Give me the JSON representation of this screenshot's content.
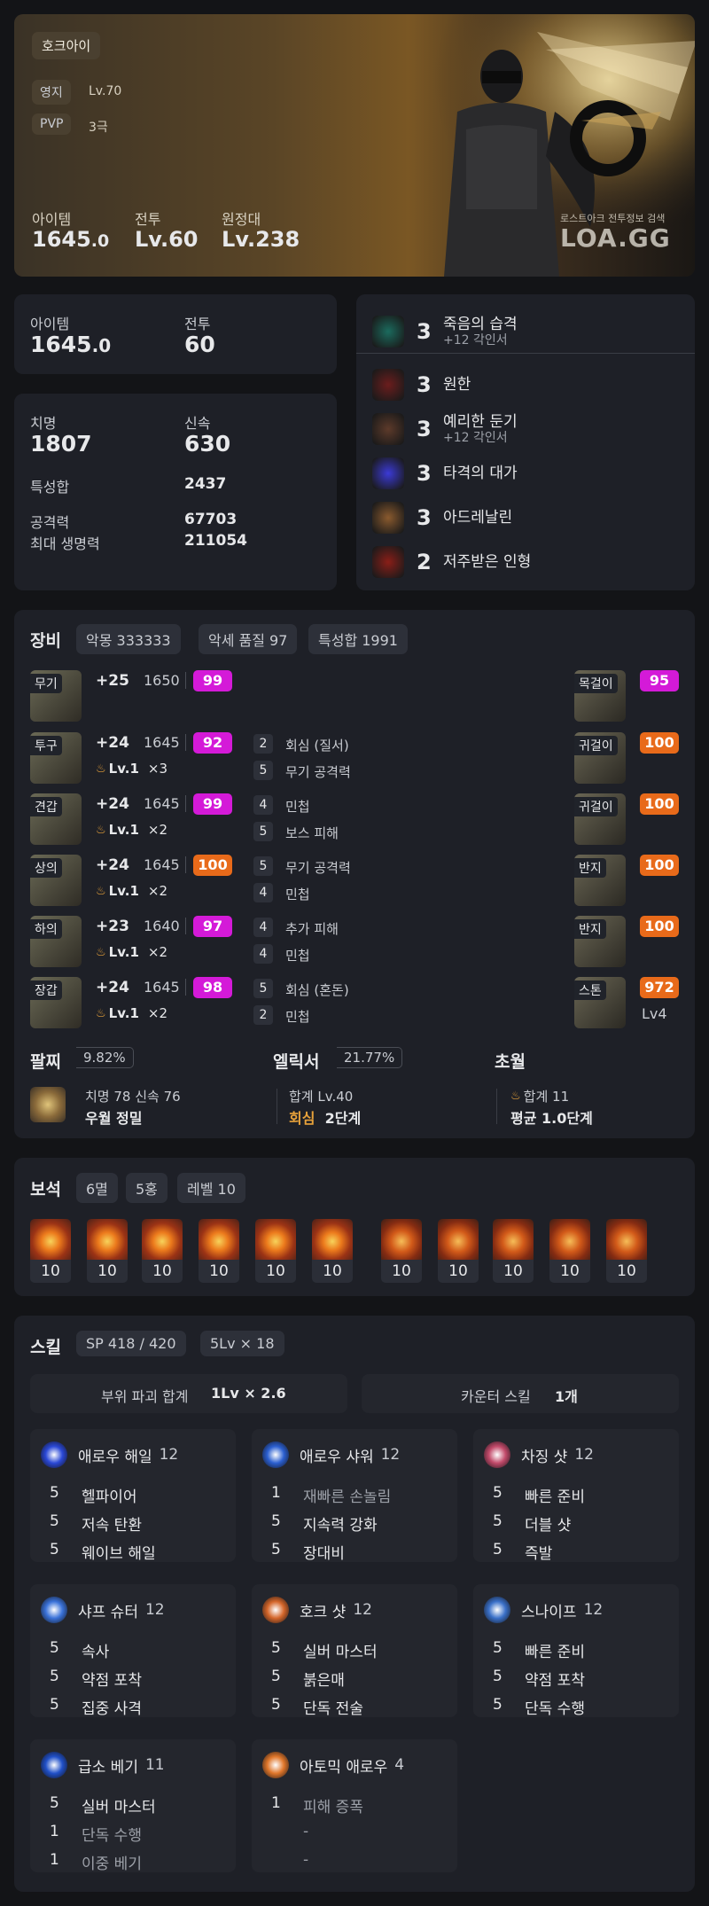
{
  "profile": {
    "class_name": "호크아이",
    "territory_label": "영지",
    "territory_value": "Lv.70",
    "pvp_label": "PVP",
    "pvp_value": "3극",
    "item_label": "아이템",
    "item_value_main": "1645",
    "item_value_dec": ".0",
    "combat_label": "전투",
    "combat_value": "Lv.60",
    "expedition_label": "원정대",
    "expedition_value": "Lv.238",
    "watermark_small": "로스트아크 전투정보 검색",
    "watermark_logo": "LOA.GG"
  },
  "stats": {
    "item_label": "아이템",
    "item_value_main": "1645",
    "item_value_dec": ".0",
    "combat_label": "전투",
    "combat_value": "60",
    "crit_label": "치명",
    "crit_value": "1807",
    "swift_label": "신속",
    "swift_value": "630",
    "spec_sum_label": "특성합",
    "spec_sum_value": "2437",
    "attack_label": "공격력",
    "attack_value": "67703",
    "hp_label": "최대 생명력",
    "hp_value": "211054"
  },
  "engravings": [
    {
      "level": "3",
      "name": "죽음의 습격",
      "sub": "+12 각인서",
      "color": "#1b6b5e"
    },
    {
      "level": "3",
      "name": "원한",
      "sub": "",
      "color": "#6b1d1d"
    },
    {
      "level": "3",
      "name": "예리한 둔기",
      "sub": "+12 각인서",
      "color": "#5d3a2a"
    },
    {
      "level": "3",
      "name": "타격의 대가",
      "sub": "",
      "color": "#3b3ad6"
    },
    {
      "level": "3",
      "name": "아드레날린",
      "sub": "",
      "color": "#8a5a2e"
    },
    {
      "level": "2",
      "name": "저주받은 인형",
      "sub": "",
      "color": "#8a1e18"
    }
  ],
  "equipment": {
    "title": "장비",
    "pills": [
      "악몽 333333",
      "악세 품질 97",
      "특성합 1991"
    ],
    "armor": [
      {
        "tag": "무기",
        "upgrade": "+25",
        "ilvl": "1650",
        "quality": "99",
        "qcolor": "pur",
        "elixir": "",
        "elixir_x": "",
        "opts": []
      },
      {
        "tag": "투구",
        "upgrade": "+24",
        "ilvl": "1645",
        "quality": "92",
        "qcolor": "pur",
        "elixir": "Lv.1",
        "elixir_x": "×3",
        "opts": [
          {
            "n": "2",
            "t": "회심 (질서)"
          },
          {
            "n": "5",
            "t": "무기 공격력"
          }
        ]
      },
      {
        "tag": "견갑",
        "upgrade": "+24",
        "ilvl": "1645",
        "quality": "99",
        "qcolor": "pur",
        "elixir": "Lv.1",
        "elixir_x": "×2",
        "opts": [
          {
            "n": "4",
            "t": "민첩"
          },
          {
            "n": "5",
            "t": "보스 피해"
          }
        ]
      },
      {
        "tag": "상의",
        "upgrade": "+24",
        "ilvl": "1645",
        "quality": "100",
        "qcolor": "org",
        "elixir": "Lv.1",
        "elixir_x": "×2",
        "opts": [
          {
            "n": "5",
            "t": "무기 공격력"
          },
          {
            "n": "4",
            "t": "민첩"
          }
        ]
      },
      {
        "tag": "하의",
        "upgrade": "+23",
        "ilvl": "1640",
        "quality": "97",
        "qcolor": "pur",
        "elixir": "Lv.1",
        "elixir_x": "×2",
        "opts": [
          {
            "n": "4",
            "t": "추가 피해"
          },
          {
            "n": "4",
            "t": "민첩"
          }
        ]
      },
      {
        "tag": "장갑",
        "upgrade": "+24",
        "ilvl": "1645",
        "quality": "98",
        "qcolor": "pur",
        "elixir": "Lv.1",
        "elixir_x": "×2",
        "opts": [
          {
            "n": "5",
            "t": "회심 (혼돈)"
          },
          {
            "n": "2",
            "t": "민첩"
          }
        ]
      }
    ],
    "accessories": [
      {
        "tag": "목걸이",
        "quality": "95",
        "qcolor": "pur",
        "extra": ""
      },
      {
        "tag": "귀걸이",
        "quality": "100",
        "qcolor": "org",
        "extra": ""
      },
      {
        "tag": "귀걸이",
        "quality": "100",
        "qcolor": "org",
        "extra": ""
      },
      {
        "tag": "반지",
        "quality": "100",
        "qcolor": "org",
        "extra": ""
      },
      {
        "tag": "반지",
        "quality": "100",
        "qcolor": "org",
        "extra": ""
      },
      {
        "tag": "스톤",
        "quality": "972",
        "qcolor": "org",
        "extra": "Lv4"
      }
    ],
    "bracelet": {
      "title": "팔찌",
      "pct": "9.82%",
      "line1": "치명 78  신속 76",
      "line2": "우월  정밀"
    },
    "elixir": {
      "title": "엘릭서",
      "pct": "21.77%",
      "line1": "합계 Lv.40",
      "line2a": "회심",
      "line2b": "2단계"
    },
    "transcend": {
      "title": "초월",
      "line1": "합계 11",
      "line2": "평균 1.0단계"
    }
  },
  "gems": {
    "title": "보석",
    "pills": [
      "6멸",
      "5홍",
      "레벨 10"
    ],
    "levels": [
      "10",
      "10",
      "10",
      "10",
      "10",
      "10",
      "10",
      "10",
      "10",
      "10",
      "10"
    ]
  },
  "skills": {
    "title": "스킬",
    "pills": [
      "SP 418 / 420",
      "5Lv × 18"
    ],
    "break_label": "부위 파괴 합계",
    "break_value": "1Lv × 2.6",
    "counter_label": "카운터 스킬",
    "counter_value": "1개",
    "cards": [
      {
        "name": "애로우 해일",
        "lv": "12",
        "color": "#2a48d6",
        "lines": [
          {
            "n": "5",
            "t": "헬파이어"
          },
          {
            "n": "5",
            "t": "저속 탄환"
          },
          {
            "n": "5",
            "t": "웨이브 해일"
          }
        ]
      },
      {
        "name": "애로우 샤워",
        "lv": "12",
        "color": "#2b5fd0",
        "lines": [
          {
            "n": "1",
            "t": "재빠른 손놀림"
          },
          {
            "n": "5",
            "t": "지속력 강화"
          },
          {
            "n": "5",
            "t": "장대비"
          }
        ]
      },
      {
        "name": "차징 샷",
        "lv": "12",
        "color": "#c24a6a",
        "lines": [
          {
            "n": "5",
            "t": "빠른 준비"
          },
          {
            "n": "5",
            "t": "더블 샷"
          },
          {
            "n": "5",
            "t": "즉발"
          }
        ]
      },
      {
        "name": "샤프 슈터",
        "lv": "12",
        "color": "#3a72d9",
        "lines": [
          {
            "n": "5",
            "t": "속사"
          },
          {
            "n": "5",
            "t": "약점 포착"
          },
          {
            "n": "5",
            "t": "집중 사격"
          }
        ]
      },
      {
        "name": "호크 샷",
        "lv": "12",
        "color": "#d4662a",
        "lines": [
          {
            "n": "5",
            "t": "실버 마스터"
          },
          {
            "n": "5",
            "t": "붉은매"
          },
          {
            "n": "5",
            "t": "단독 전술"
          }
        ]
      },
      {
        "name": "스나이프",
        "lv": "12",
        "color": "#3a70c8",
        "lines": [
          {
            "n": "5",
            "t": "빠른 준비"
          },
          {
            "n": "5",
            "t": "약점 포착"
          },
          {
            "n": "5",
            "t": "단독 수행"
          }
        ]
      },
      {
        "name": "급소 베기",
        "lv": "11",
        "color": "#2050c8",
        "lines": [
          {
            "n": "5",
            "t": "실버 마스터"
          },
          {
            "n": "1",
            "t": "단독 수행"
          },
          {
            "n": "1",
            "t": "이중 베기"
          }
        ]
      },
      {
        "name": "아토믹 애로우",
        "lv": "4",
        "color": "#e0762a",
        "lines": [
          {
            "n": "1",
            "t": "피해 증폭"
          },
          {
            "n": "",
            "t": "-"
          },
          {
            "n": "",
            "t": "-"
          }
        ]
      }
    ]
  },
  "colors": {
    "accent_purple": "#d41ad8",
    "accent_orange": "#e86a1a",
    "elixir_orange": "#e8a23a",
    "bg": "#131417",
    "card": "#1e2027"
  }
}
